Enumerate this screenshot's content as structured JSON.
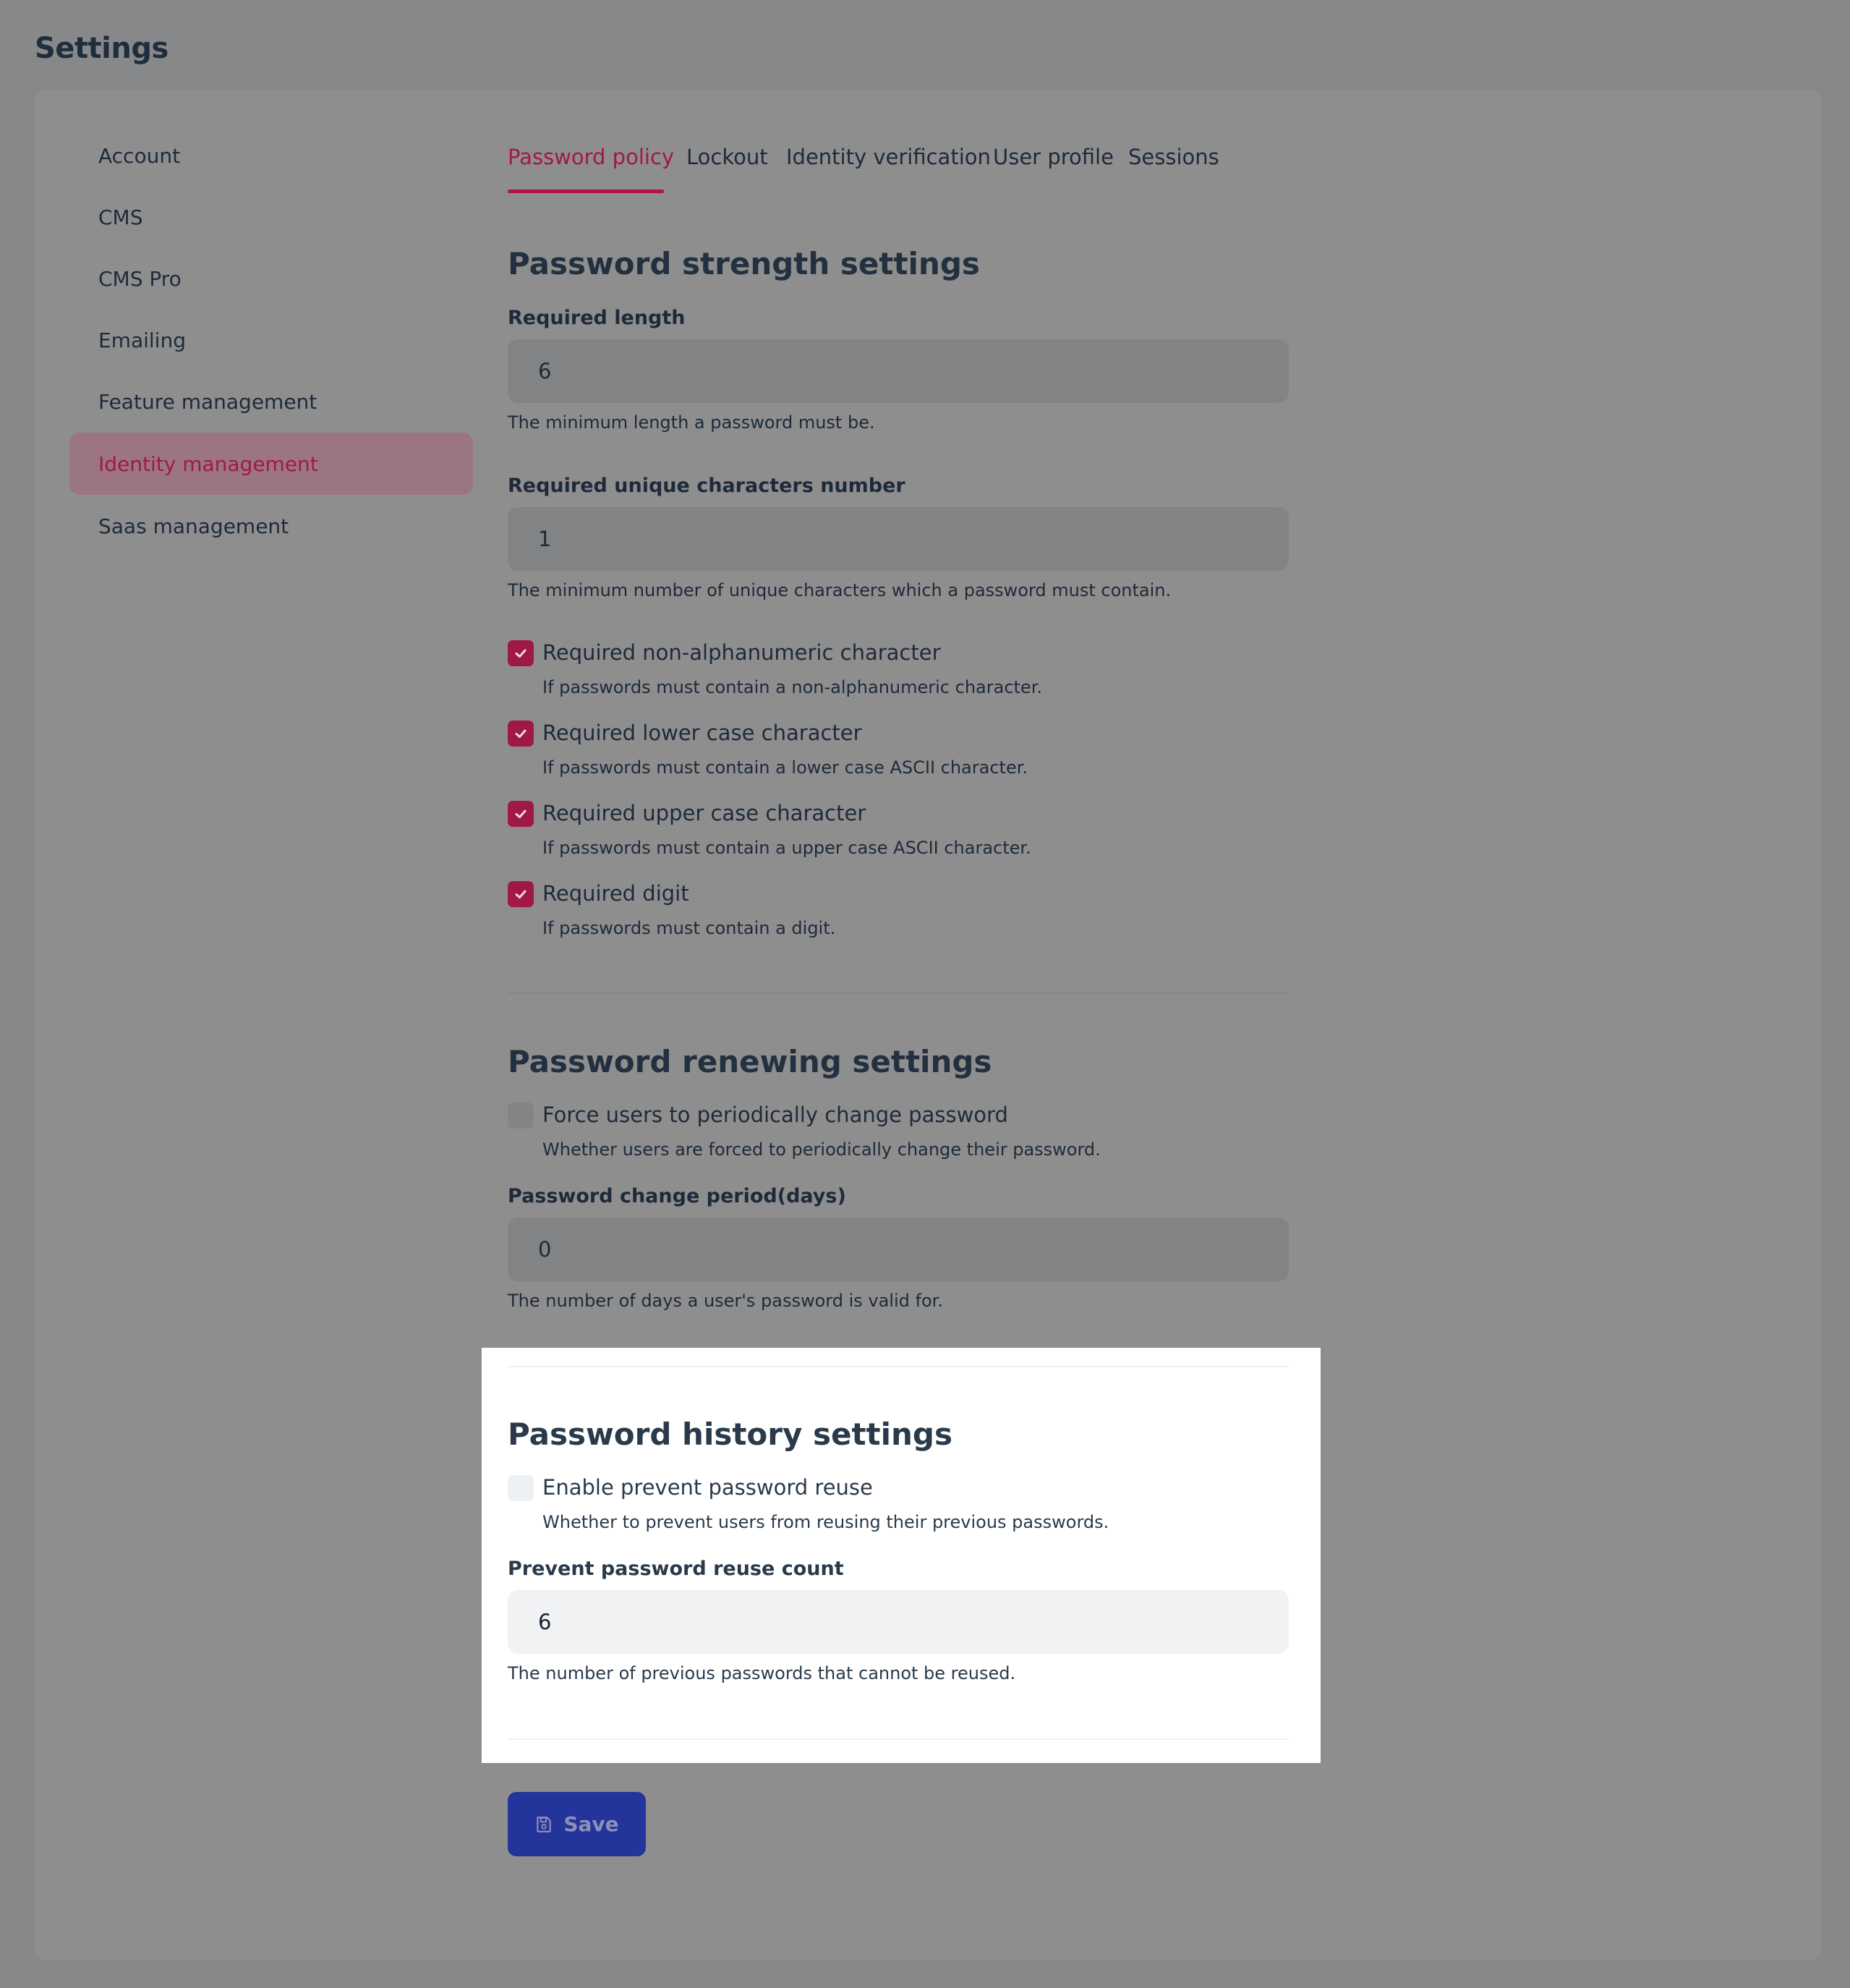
{
  "page": {
    "title": "Settings"
  },
  "sidebar": {
    "items": [
      {
        "label": "Account"
      },
      {
        "label": "CMS"
      },
      {
        "label": "CMS Pro"
      },
      {
        "label": "Emailing"
      },
      {
        "label": "Feature management"
      },
      {
        "label": "Identity management",
        "active": true
      },
      {
        "label": "Saas management"
      }
    ]
  },
  "tabs": [
    {
      "label": "Password policy",
      "active": true
    },
    {
      "label": "Lockout"
    },
    {
      "label": "Identity verification"
    },
    {
      "label": "User profile"
    },
    {
      "label": "Sessions"
    }
  ],
  "strength": {
    "title": "Password strength settings",
    "required_length": {
      "label": "Required length",
      "value": "6",
      "help": "The minimum length a password must be."
    },
    "unique_chars": {
      "label": "Required unique characters number",
      "value": "1",
      "help": "The minimum number of unique characters which a password must contain."
    },
    "checks": [
      {
        "label": "Required non-alphanumeric character",
        "help": "If passwords must contain a non-alphanumeric character.",
        "checked": true
      },
      {
        "label": "Required lower case character",
        "help": "If passwords must contain a lower case ASCII character.",
        "checked": true
      },
      {
        "label": "Required upper case character",
        "help": "If passwords must contain a upper case ASCII character.",
        "checked": true
      },
      {
        "label": "Required digit",
        "help": "If passwords must contain a digit.",
        "checked": true
      }
    ]
  },
  "renewing": {
    "title": "Password renewing settings",
    "force": {
      "label": "Force users to periodically change password",
      "help": "Whether users are forced to periodically change their password.",
      "checked": false
    },
    "period": {
      "label": "Password change period(days)",
      "value": "0",
      "help": "The number of days a user's password is valid for."
    }
  },
  "history": {
    "title": "Password history settings",
    "prevent": {
      "label": "Enable prevent password reuse",
      "help": "Whether to prevent users from reusing their previous passwords.",
      "checked": false
    },
    "count": {
      "label": "Prevent password reuse count",
      "value": "6",
      "help": "The number of previous passwords that cannot be reused."
    }
  },
  "actions": {
    "save_label": "Save"
  },
  "colors": {
    "accent": "#b0144b",
    "primary_button": "#23349a"
  }
}
